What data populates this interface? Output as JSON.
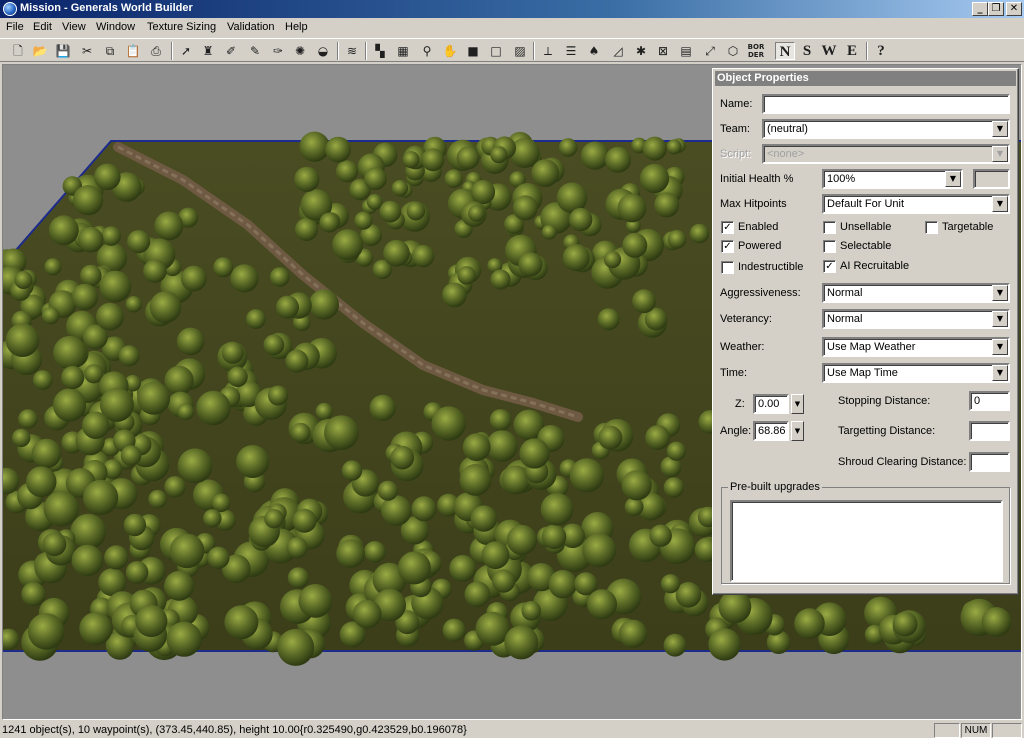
{
  "window": {
    "title": "Mission - Generals World Builder",
    "minimize_glyph": "_",
    "maximize_glyph": "❐",
    "close_glyph": "✕"
  },
  "menu": [
    "File",
    "Edit",
    "View",
    "Window",
    "Texture Sizing",
    "Validation",
    "Help"
  ],
  "toolbar": {
    "icons": [
      "new-file-icon",
      "open-folder-icon",
      "save-icon",
      "cut-icon",
      "copy-icon",
      "paste-icon",
      "print-icon",
      "pointer-icon",
      "object-tool-icon",
      "brush-icon",
      "feather-brush-icon",
      "smooth-brush-icon",
      "explosion-icon",
      "hill-icon",
      "water-waves-icon",
      "tile-paint-icon",
      "checker-tile-icon",
      "eyedropper-icon",
      "hand-icon",
      "solid-square-icon",
      "outline-square-icon",
      "gradient-icon",
      "axis-icon",
      "road-icon",
      "tree-icon",
      "ramp-icon",
      "blob-icon",
      "mesh-icon",
      "build-list-icon",
      "waypoint-icon",
      "polygon-icon",
      "help-icon"
    ],
    "border_label_top": "BOR",
    "border_label_bottom": "DER",
    "direction_letters": [
      "N",
      "S",
      "W",
      "E"
    ],
    "active_direction": "N",
    "help_glyph": "?"
  },
  "object_properties": {
    "title": "Object Properties",
    "name_label": "Name:",
    "name_value": "",
    "team_label": "Team:",
    "team_value": "(neutral)",
    "script_label": "Script:",
    "script_value": "<none>",
    "initial_health_label": "Initial Health %",
    "initial_health_value": "100%",
    "initial_health_custom": "",
    "max_hitpoints_label": "Max Hitpoints",
    "max_hitpoints_value": "Default For Unit",
    "checkboxes": [
      {
        "label": "Enabled",
        "checked": true
      },
      {
        "label": "Unsellable",
        "checked": false
      },
      {
        "label": "Targetable",
        "checked": false
      },
      {
        "label": "Powered",
        "checked": true
      },
      {
        "label": "Selectable",
        "checked": false
      },
      {
        "label": "Indestructible",
        "checked": false
      },
      {
        "label": "AI Recruitable",
        "checked": true
      }
    ],
    "aggressiveness_label": "Aggressiveness:",
    "aggressiveness_value": "Normal",
    "veterancy_label": "Veterancy:",
    "veterancy_value": "Normal",
    "weather_label": "Weather:",
    "weather_value": "Use Map Weather",
    "time_label": "Time:",
    "time_value": "Use Map Time",
    "z_label": "Z:",
    "z_value": "0.00",
    "angle_label": "Angle:",
    "angle_value": "68.86",
    "stopping_distance_label": "Stopping Distance:",
    "stopping_distance_value": "0",
    "targetting_distance_label": "Targetting Distance:",
    "targetting_distance_value": "",
    "shroud_distance_label": "Shroud Clearing Distance:",
    "shroud_distance_value": "",
    "upgrades_label": "Pre-built upgrades"
  },
  "status": {
    "text": "1241 object(s), 10 waypoint(s), (373.45,440.85), height 10.00{r0.325490,g0.423529,b0.196078}",
    "pane_empty": "",
    "num": "NUM"
  },
  "colors": {
    "terrain": "#4a4a22",
    "terrain_dark": "#38391a",
    "road": "#6e5a42",
    "tree_light": "#8a9a3a",
    "tree_dark": "#3a4a18",
    "sky": "#8e8e8e",
    "map_border": "#1c2b8c"
  }
}
